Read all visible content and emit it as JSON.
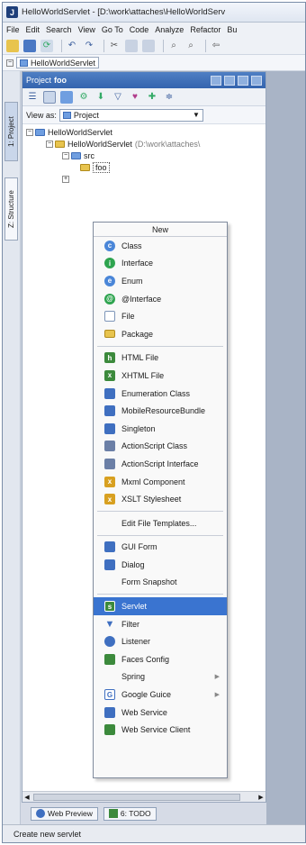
{
  "window": {
    "title": "HelloWorldServlet - [D:\\work\\attaches\\HelloWorldServ"
  },
  "menubar": {
    "items": [
      "File",
      "Edit",
      "Search",
      "View",
      "Go To",
      "Code",
      "Analyze",
      "Refactor",
      "Bu"
    ]
  },
  "navbar": {
    "crumb": "HelloWorldServlet"
  },
  "left_strip": {
    "tab1": "1: Project",
    "tab2": "Z: Structure"
  },
  "project_panel": {
    "header_label": "Project",
    "header_name": "foo",
    "view_as_label": "View as:",
    "view_as_value": "Project"
  },
  "tree": {
    "root": "HelloWorldServlet",
    "module": "HelloWorldServlet",
    "module_path": "(D:\\work\\attaches\\",
    "src": "src",
    "foo": "foo"
  },
  "context_menu": {
    "header": "New",
    "group1": [
      {
        "label": "Class",
        "icon": "class-icon",
        "color": "#4a86d8"
      },
      {
        "label": "Interface",
        "icon": "interface-icon",
        "color": "#2ea44f"
      },
      {
        "label": "Enum",
        "icon": "enum-icon",
        "color": "#4a86d8"
      },
      {
        "label": "@Interface",
        "icon": "annotation-icon",
        "color": "#2ea44f"
      },
      {
        "label": "File",
        "icon": "file-icon",
        "color": "#7d95b8"
      },
      {
        "label": "Package",
        "icon": "package-icon",
        "color": "#e8c44e"
      }
    ],
    "group2": [
      {
        "label": "HTML File",
        "icon": "html-file-icon",
        "color": "#3c8a3c"
      },
      {
        "label": "XHTML File",
        "icon": "xhtml-file-icon",
        "color": "#3c8a3c"
      },
      {
        "label": "Enumeration Class",
        "icon": "enumeration-class-icon",
        "color": "#3f6fc0"
      },
      {
        "label": "MobileResourceBundle",
        "icon": "resource-bundle-icon",
        "color": "#3f6fc0"
      },
      {
        "label": "Singleton",
        "icon": "singleton-icon",
        "color": "#3f6fc0"
      },
      {
        "label": "ActionScript Class",
        "icon": "actionscript-class-icon",
        "color": "#6b7fa6"
      },
      {
        "label": "ActionScript Interface",
        "icon": "actionscript-interface-icon",
        "color": "#6b7fa6"
      },
      {
        "label": "Mxml Component",
        "icon": "mxml-icon",
        "color": "#d8a020"
      },
      {
        "label": "XSLT Stylesheet",
        "icon": "xslt-icon",
        "color": "#d8a020"
      }
    ],
    "edit_templates": "Edit File Templates...",
    "group3": [
      {
        "label": "GUI Form",
        "icon": "gui-form-icon",
        "color": "#3f6fc0",
        "noicon": false
      },
      {
        "label": "Dialog",
        "icon": "dialog-icon",
        "color": "#3f6fc0",
        "noicon": false
      },
      {
        "label": "Form Snapshot",
        "icon": "",
        "color": "",
        "noicon": true
      }
    ],
    "group4": [
      {
        "label": "Servlet",
        "icon": "servlet-icon",
        "color": "#3c8a3c",
        "selected": true,
        "submenu": false
      },
      {
        "label": "Filter",
        "icon": "filter-icon",
        "color": "#3f6fc0",
        "selected": false,
        "submenu": false
      },
      {
        "label": "Listener",
        "icon": "listener-icon",
        "color": "#3f6fc0",
        "selected": false,
        "submenu": false
      },
      {
        "label": "Faces Config",
        "icon": "faces-config-icon",
        "color": "#3c8a3c",
        "selected": false,
        "submenu": false
      },
      {
        "label": "Spring",
        "icon": "",
        "color": "",
        "selected": false,
        "submenu": true
      },
      {
        "label": "Google Guice",
        "icon": "google-guice-icon",
        "color": "#3f6fc0",
        "selected": false,
        "submenu": true
      },
      {
        "label": "Web Service",
        "icon": "web-service-icon",
        "color": "#3f6fc0",
        "selected": false,
        "submenu": false
      },
      {
        "label": "Web Service Client",
        "icon": "web-service-client-icon",
        "color": "#3c8a3c",
        "selected": false,
        "submenu": false
      }
    ]
  },
  "bottom_tabs": {
    "web_preview": "Web Preview",
    "todo": "6: TODO"
  },
  "statusbar": {
    "text": "Create new servlet"
  }
}
